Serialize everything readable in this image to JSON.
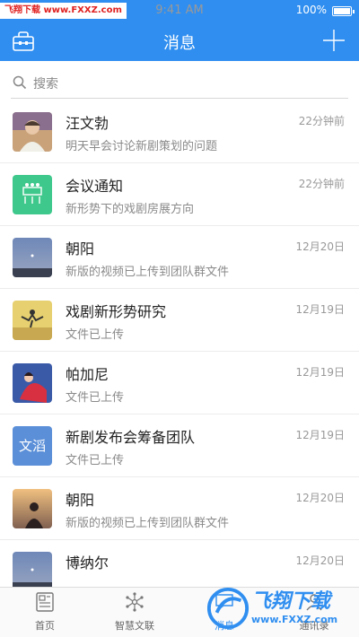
{
  "status_bar": {
    "watermark": "飞翔下载 www.FXXZ.com",
    "time": "9:41 AM",
    "battery": "100%"
  },
  "header": {
    "title": "消息",
    "left_icon": "briefcase-icon",
    "right_icon": "plus-icon"
  },
  "search": {
    "placeholder": "搜索"
  },
  "messages": [
    {
      "name": "汪文勃",
      "preview": "明天早会讨论新剧策划的问题",
      "time": "22分钟前",
      "avatar": "photo-portrait"
    },
    {
      "name": "会议通知",
      "preview": "新形势下的戏剧房展方向",
      "time": "22分钟前",
      "avatar": "meeting-icon"
    },
    {
      "name": "朝阳",
      "preview": "新版的视频已上传到团队群文件",
      "time": "12月20日",
      "avatar": "photo-sky"
    },
    {
      "name": "戏剧新形势研究",
      "preview": "文件已上传",
      "time": "12月19日",
      "avatar": "photo-jump"
    },
    {
      "name": "帕加尼",
      "preview": "文件已上传",
      "time": "12月19日",
      "avatar": "photo-red"
    },
    {
      "name": "新剧发布会筹备团队",
      "preview": "文件已上传",
      "time": "12月19日",
      "avatar_text": "文滔"
    },
    {
      "name": "朝阳",
      "preview": "新版的视频已上传到团队群文件",
      "time": "12月20日",
      "avatar": "photo-sunset"
    },
    {
      "name": "博纳尔",
      "preview": "",
      "time": "12月20日",
      "avatar": "photo-sky"
    }
  ],
  "tabs": [
    {
      "label": "首页",
      "icon": "document-icon"
    },
    {
      "label": "智慧文联",
      "icon": "network-icon"
    },
    {
      "label": "消息",
      "icon": "chat-icon"
    },
    {
      "label": "通讯录",
      "icon": "contacts-icon"
    }
  ],
  "brand_watermark": {
    "text": "飞翔下载",
    "url": "www.FXXZ.com"
  },
  "colors": {
    "accent": "#2f8ef0",
    "meeting": "#3ec88c",
    "text_avatar": "#5b8fd8"
  }
}
